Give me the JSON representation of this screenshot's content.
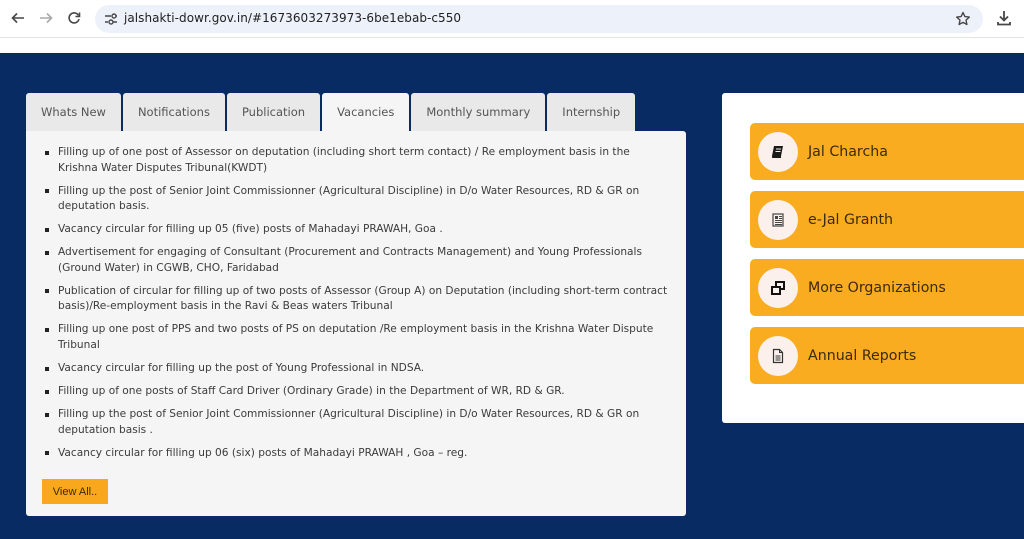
{
  "browser": {
    "url": "jalshakti-dowr.gov.in/#1673603273973-6be1ebab-c550",
    "icons": {
      "back": "arrow-left-icon",
      "forward": "arrow-right-icon",
      "reload": "reload-icon",
      "site_info": "tune-icon",
      "bookmark": "star-icon",
      "download": "download-icon"
    }
  },
  "tabs": [
    {
      "label": "Whats New",
      "active": false
    },
    {
      "label": "Notifications",
      "active": false
    },
    {
      "label": "Publication",
      "active": false
    },
    {
      "label": "Vacancies",
      "active": true
    },
    {
      "label": "Monthly summary",
      "active": false
    },
    {
      "label": "Internship",
      "active": false
    }
  ],
  "vacancies": {
    "items": [
      "Filling up of one post of Assessor on deputation (including short term contact) / Re employment basis in the Krishna Water Disputes Tribunal(KWDT)",
      "Filling up the post of Senior Joint Commissionner (Agricultural Discipline) in D/o Water Resources, RD & GR on deputation basis.",
      "Vacancy circular for filling up 05 (five) posts of Mahadayi PRAWAH, Goa .",
      "Advertisement for engaging of Consultant (Procurement and Contracts Management) and Young Professionals (Ground Water) in CGWB, CHO, Faridabad",
      "Publication of circular for filling up of two posts of Assessor (Group A) on Deputation (including short-term contract basis)/Re-employment basis in the Ravi & Beas waters Tribunal",
      "Filling up one post of PPS and two posts of PS on deputation /Re employment basis in the Krishna Water Dispute Tribunal",
      "Vacancy circular for filling up the post of Young Professional in NDSA.",
      "Filling up of one posts of Staff Card Driver (Ordinary Grade) in the Department of WR, RD & GR.",
      "Filling up the post of Senior Joint Commissionner (Agricultural Discipline) in D/o Water Resources, RD & GR on deputation basis .",
      "Vacancy circular for filling up 06 (six) posts of Mahadayi PRAWAH , Goa – reg."
    ],
    "view_all_label": "View All.."
  },
  "quick_links": [
    {
      "label": "Jal Charcha",
      "icon": "book-icon"
    },
    {
      "label": "e-Jal Granth",
      "icon": "newspaper-icon"
    },
    {
      "label": "More Organizations",
      "icon": "window-restore-icon"
    },
    {
      "label": "Annual Reports",
      "icon": "document-icon"
    }
  ],
  "colors": {
    "page_background": "#082b64",
    "accent": "#f9ac1f",
    "panel": "#f5f5f5",
    "tab_inactive": "#e9e9e9"
  }
}
